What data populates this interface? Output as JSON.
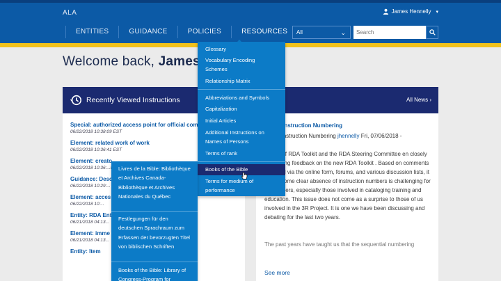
{
  "header": {
    "brand": "ALA",
    "user_name": "James Hennelly",
    "nav": [
      "ENTITIES",
      "GUIDANCE",
      "POLICIES",
      "RESOURCES"
    ],
    "scope_select": "All",
    "search_placeholder": "Search"
  },
  "welcome": {
    "prefix": "Welcome back, ",
    "name": "James H"
  },
  "recent": {
    "title": "Recently Viewed Instructions",
    "items": [
      {
        "title": "Special: authorized access point for official commu",
        "date": "06/22/2018 10:38:09 EST"
      },
      {
        "title": "Element: related work of work",
        "date": "06/22/2018 10:36:41 EST"
      },
      {
        "title": "Element: creato",
        "date": "06/22/2018 10:36:...EST"
      },
      {
        "title": "Guidance: Desc",
        "date": "06/22/2018 10:29:..."
      },
      {
        "title": "Element: acces",
        "date": "06/22/2018 10:..."
      },
      {
        "title": "Entity: RDA Ent",
        "date": "06/21/2018 04:13..."
      },
      {
        "title": "Element: imme",
        "date": "06/21/2018 04:13..."
      },
      {
        "title": "Entity: Item",
        "date": ""
      }
    ]
  },
  "news": {
    "all_news_label": "All News",
    "title": "ent on Instruction Numbering",
    "meta_prefix": "ent on Instruction Numbering ",
    "author": "jhennelly",
    "meta_date": " Fri, 07/06/2018 -",
    "body": "lishers of RDA Toolkit and the RDA Steering Committee en closely monitoring feedback on the new RDA Toolkit . Based on comments provided via the online form, forums, and various discussion lists, it has become clear absence of instruction numbers is challenging for some users, especially those involved in cataloging training and education. This issue does not come as a surprise to those of us involved in the 3R Project. It is one we have been discussing and debating for the last two years.",
    "body2": "The past years have taught us that the sequential numbering",
    "see_more": "See more"
  },
  "resources_menu": {
    "items": [
      "Glossary",
      "Vocabulary Encoding Schemes",
      "Relationship Matrix",
      "Abbreviations and Symbols",
      "Capitalization",
      "Initial Articles",
      "Additional Instructions on Names of Persons",
      "Terms of rank",
      "Books of the Bible",
      "Terms for medium of performance"
    ],
    "active": "Books of the Bible"
  },
  "bible_flyout": {
    "items": [
      "Livres de la Bible: Bibliothèque et Archives Canada-Bibliothèque et Archives Nationales du Québec",
      "Festlegungen für den deutschen Sprachraum zum Erfassen der bevorzugten Titel von biblischen Schriften",
      "Books of the Bible: Library of Congress-Program for"
    ]
  },
  "colors": {
    "header_blue": "#0c5aa6",
    "gold_stripe": "#f2c21b",
    "panel_header": "#1b2a70",
    "menu_blue": "#0c7bc7"
  },
  "icons": [
    "user-icon",
    "chevron-down-icon",
    "search-icon",
    "history-icon",
    "chevron-right-icon",
    "cursor-pointer-icon"
  ]
}
